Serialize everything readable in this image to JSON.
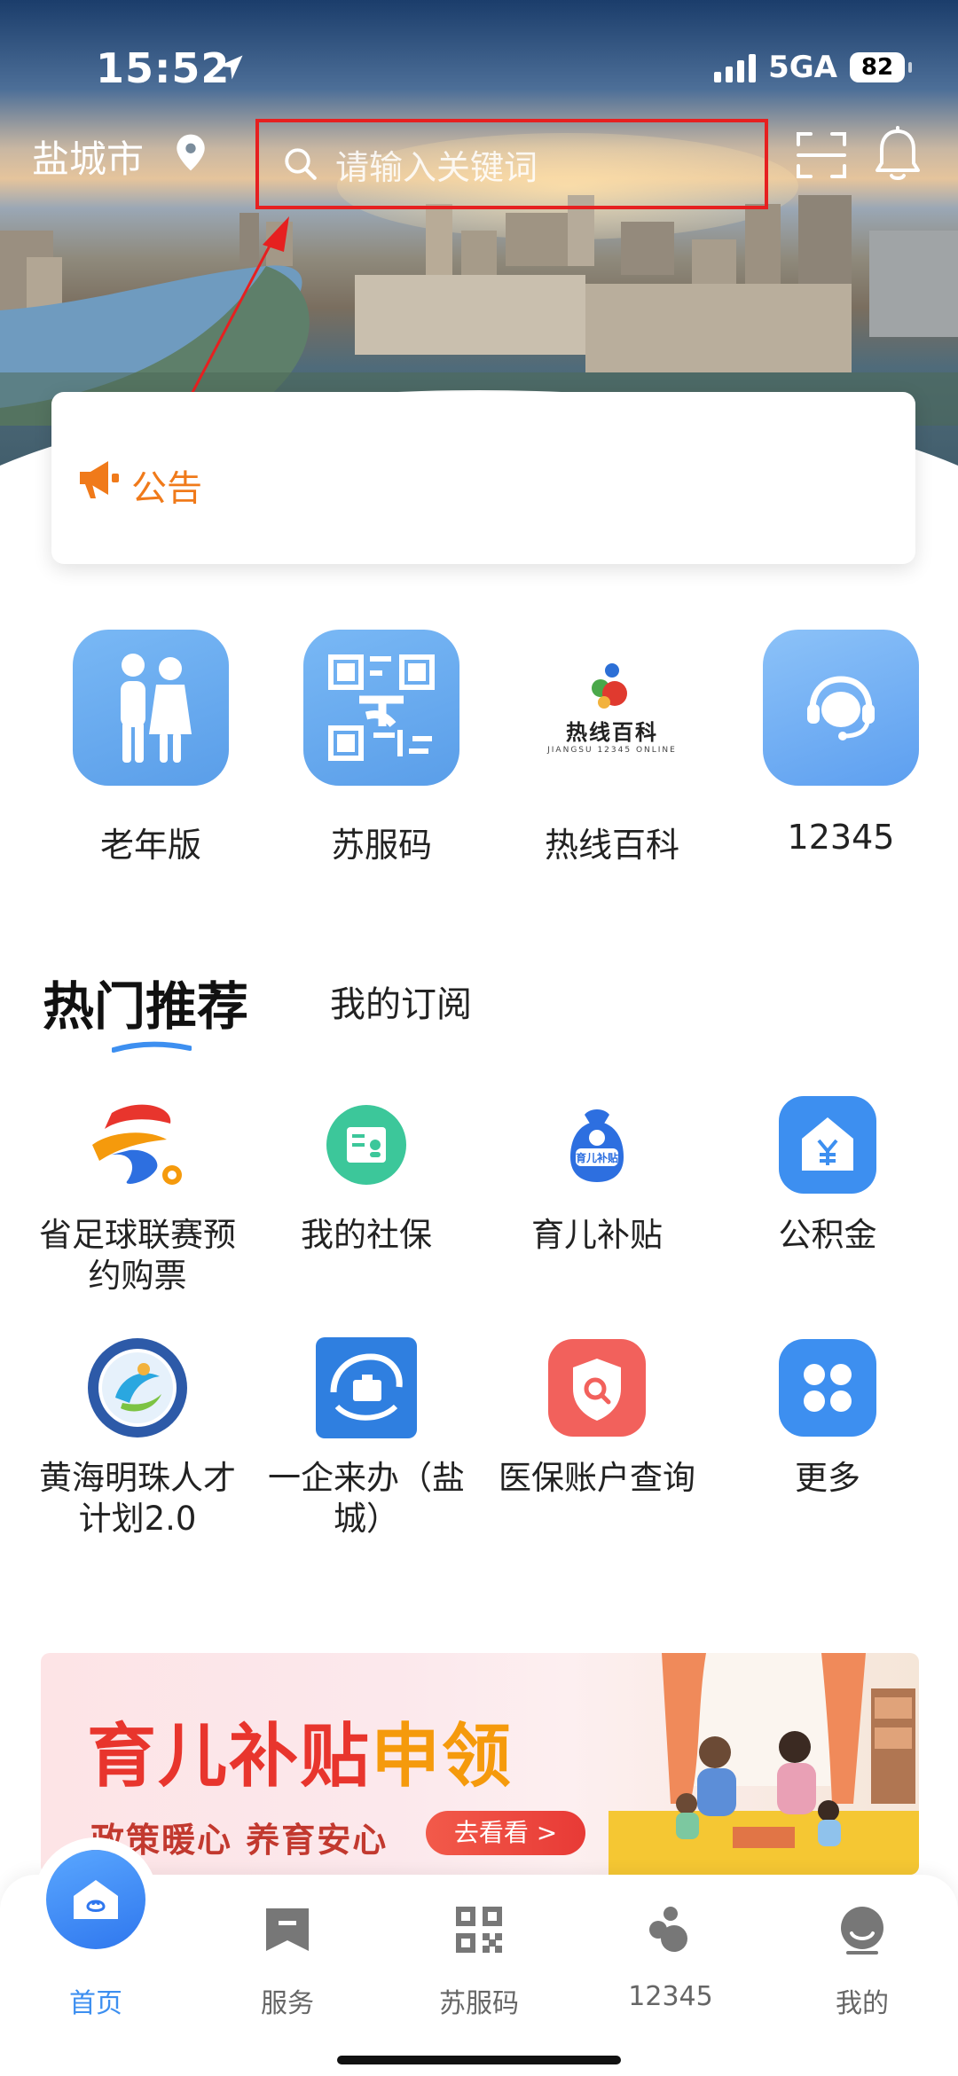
{
  "status_bar": {
    "time": "15:52",
    "network": "5GA",
    "battery": "82"
  },
  "header": {
    "city": "盐城市",
    "search_placeholder": "请输入关键词"
  },
  "notice": {
    "label": "公告"
  },
  "quick_entries": [
    {
      "label": "老年版",
      "icon": "elderly-couple-icon"
    },
    {
      "label": "苏服码",
      "icon": "qr-code-icon"
    },
    {
      "label": "热线百科",
      "icon": "hotline-encyclopedia-logo",
      "logo_text": "热线百科",
      "logo_sub": "JIANGSU 12345 ONLINE"
    },
    {
      "label": "12345",
      "icon": "headset-agent-icon"
    }
  ],
  "tabs": {
    "hot": "热门推荐",
    "subscribed": "我的订阅"
  },
  "services": [
    {
      "label": "省足球联赛预约购票",
      "icon": "football-league-logo"
    },
    {
      "label": "我的社保",
      "icon": "social-security-card-icon"
    },
    {
      "label": "育儿补贴",
      "icon": "childcare-subsidy-bag-icon",
      "icon_text": "育儿补贴"
    },
    {
      "label": "公积金",
      "icon": "housing-fund-icon"
    },
    {
      "label": "黄海明珠人才计划2.0",
      "icon": "talent-plan-logo"
    },
    {
      "label": "一企来办（盐城）",
      "icon": "enterprise-service-logo"
    },
    {
      "label": "医保账户查询",
      "icon": "medical-insurance-search-icon"
    },
    {
      "label": "更多",
      "icon": "more-grid-icon"
    }
  ],
  "banner": {
    "title_a": "育儿补贴",
    "title_b": "申领",
    "subtitle": "政策暖心  养育安心",
    "button": "去看看 >"
  },
  "bottom_nav": [
    {
      "label": "首页",
      "icon": "home-icon",
      "active": true
    },
    {
      "label": "服务",
      "icon": "bookmark-icon",
      "active": false
    },
    {
      "label": "苏服码",
      "icon": "qr-code-icon",
      "active": false
    },
    {
      "label": "12345",
      "icon": "hotline-icon",
      "active": false
    },
    {
      "label": "我的",
      "icon": "profile-icon",
      "active": false
    }
  ],
  "colors": {
    "accent": "#3d8ff0",
    "notice": "#f07a1a",
    "highlight_box": "#e62020"
  }
}
